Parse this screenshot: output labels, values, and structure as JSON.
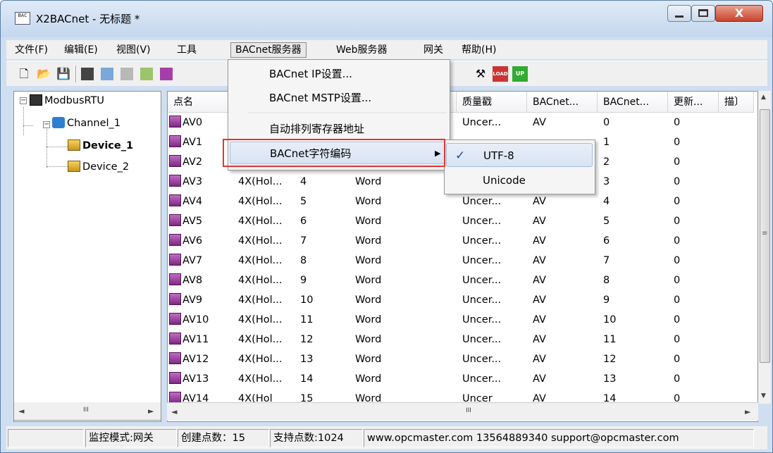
{
  "window": {
    "title": "X2BACnet - 无标题 *",
    "icon_text": "BAC",
    "close_glyph": "X"
  },
  "menubar": [
    {
      "label": "文件(F)"
    },
    {
      "label": "编辑(E)"
    },
    {
      "label": "视图(V)"
    },
    {
      "label": "工具"
    },
    {
      "label": "BACnet服务器"
    },
    {
      "label": "Web服务器"
    },
    {
      "label": "网关"
    },
    {
      "label": "帮助(H)"
    }
  ],
  "toolbar_icons": [
    "new-icon",
    "open-icon",
    "save-icon",
    "add-device-icon",
    "add-channel-icon",
    "add-point-icon",
    "edit-icon",
    "bacnet-object-icon",
    "tools-icon",
    "load-icon",
    "update-icon"
  ],
  "toolbar_glyphs": {
    "new": "🗋",
    "open": "📂",
    "save": "💾",
    "tools": "⚒",
    "load": "LOAD",
    "up": "UP"
  },
  "tree": {
    "root": "ModbusRTU",
    "channel": "Channel_1",
    "devices": [
      "Device_1",
      "Device_2"
    ],
    "expander_minus": "−"
  },
  "list": {
    "columns": [
      "点名",
      "",
      "",
      "",
      "",
      "质量戳",
      "BACnet...",
      "BACnet...",
      "更新...",
      "描〕"
    ],
    "rows": [
      {
        "name": "AV0",
        "reg": "",
        "addr": "",
        "type": "",
        "quality": "Uncer...",
        "btype": "AV",
        "inst": "0",
        "upd": "0"
      },
      {
        "name": "AV1",
        "reg": "",
        "addr": "",
        "type": "",
        "quality": "",
        "btype": "",
        "inst": "1",
        "upd": "0"
      },
      {
        "name": "AV2",
        "reg": "",
        "addr": "",
        "type": "",
        "quality": "",
        "btype": "",
        "inst": "2",
        "upd": "0"
      },
      {
        "name": "AV3",
        "reg": "4X(Hol...",
        "addr": "4",
        "type": "Word",
        "quality": "",
        "btype": "",
        "inst": "3",
        "upd": "0"
      },
      {
        "name": "AV4",
        "reg": "4X(Hol...",
        "addr": "5",
        "type": "Word",
        "quality": "Uncer...",
        "btype": "AV",
        "inst": "4",
        "upd": "0"
      },
      {
        "name": "AV5",
        "reg": "4X(Hol...",
        "addr": "6",
        "type": "Word",
        "quality": "Uncer...",
        "btype": "AV",
        "inst": "5",
        "upd": "0"
      },
      {
        "name": "AV6",
        "reg": "4X(Hol...",
        "addr": "7",
        "type": "Word",
        "quality": "Uncer...",
        "btype": "AV",
        "inst": "6",
        "upd": "0"
      },
      {
        "name": "AV7",
        "reg": "4X(Hol...",
        "addr": "8",
        "type": "Word",
        "quality": "Uncer...",
        "btype": "AV",
        "inst": "7",
        "upd": "0"
      },
      {
        "name": "AV8",
        "reg": "4X(Hol...",
        "addr": "9",
        "type": "Word",
        "quality": "Uncer...",
        "btype": "AV",
        "inst": "8",
        "upd": "0"
      },
      {
        "name": "AV9",
        "reg": "4X(Hol...",
        "addr": "10",
        "type": "Word",
        "quality": "Uncer...",
        "btype": "AV",
        "inst": "9",
        "upd": "0"
      },
      {
        "name": "AV10",
        "reg": "4X(Hol...",
        "addr": "11",
        "type": "Word",
        "quality": "Uncer...",
        "btype": "AV",
        "inst": "10",
        "upd": "0"
      },
      {
        "name": "AV11",
        "reg": "4X(Hol...",
        "addr": "12",
        "type": "Word",
        "quality": "Uncer...",
        "btype": "AV",
        "inst": "11",
        "upd": "0"
      },
      {
        "name": "AV12",
        "reg": "4X(Hol...",
        "addr": "13",
        "type": "Word",
        "quality": "Uncer...",
        "btype": "AV",
        "inst": "12",
        "upd": "0"
      },
      {
        "name": "AV13",
        "reg": "4X(Hol...",
        "addr": "14",
        "type": "Word",
        "quality": "Uncer...",
        "btype": "AV",
        "inst": "13",
        "upd": "0"
      },
      {
        "name": "AV14",
        "reg": "4X(Hol",
        "addr": "15",
        "type": "Word",
        "quality": "Uncer",
        "btype": "AV",
        "inst": "14",
        "upd": "0"
      }
    ]
  },
  "scroll": {
    "up": "▲",
    "down": "▼",
    "left": "◄",
    "right": "►",
    "grip": "≡",
    "hgrip": "III"
  },
  "bacnet_menu": {
    "items": [
      "BACnet IP设置...",
      "BACnet MSTP设置...",
      "自动排列寄存器地址",
      "BACnet字符编码"
    ],
    "submenu_arrow": "▶"
  },
  "encoding_submenu": {
    "items": [
      "UTF-8",
      "Unicode"
    ],
    "check": "✓"
  },
  "statusbar": [
    "监控模式:网关",
    "创建点数：15",
    "支持点数:1024",
    "www.opcmaster.com 13564889340 support@opcmaster.com"
  ],
  "colors": {
    "highlight_box": "#e53333",
    "accent": "#a7bcd9"
  }
}
